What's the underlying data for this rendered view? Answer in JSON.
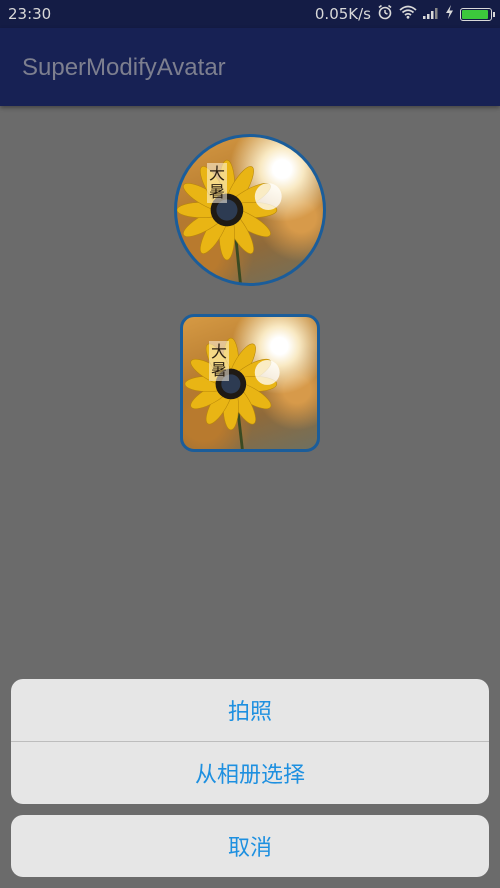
{
  "status_bar": {
    "time": "23:30",
    "network_speed": "0.05K/s",
    "icons": [
      "alarm-icon",
      "wifi-icon",
      "signal-icon",
      "charging-icon",
      "battery-icon"
    ],
    "battery_color": "#3cc83c"
  },
  "app_bar": {
    "title": "SuperModifyAvatar"
  },
  "avatars": {
    "circle_caption": [
      "大",
      "暑"
    ],
    "square_caption": [
      "大",
      "暑"
    ],
    "border_color": "#1b5d9a"
  },
  "action_sheet": {
    "take_photo_label": "拍照",
    "choose_album_label": "从相册选择",
    "cancel_label": "取消",
    "text_color": "#1e90e0"
  }
}
